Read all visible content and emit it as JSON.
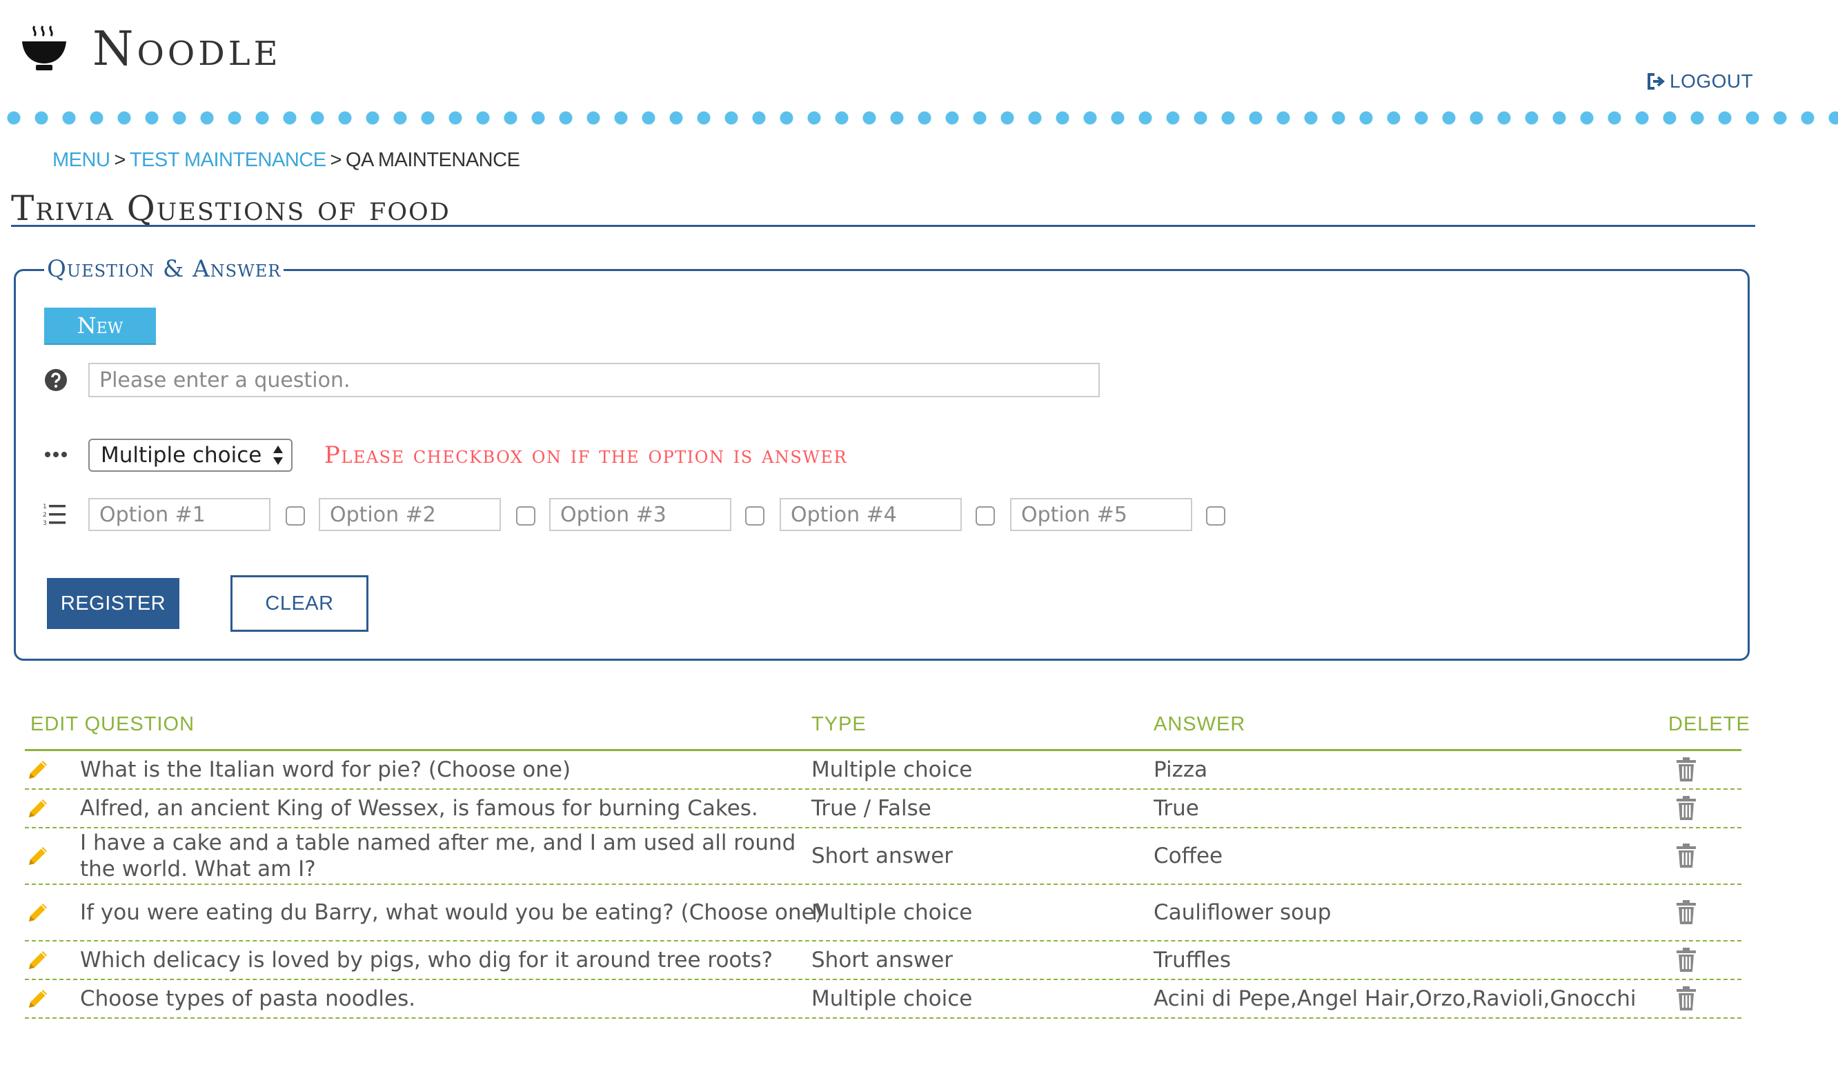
{
  "header": {
    "brand": "Noodle",
    "logout_label": "LOGOUT"
  },
  "breadcrumb": {
    "items": [
      "MENU",
      "TEST MAINTENANCE",
      "QA MAINTENANCE"
    ],
    "separator": ">"
  },
  "page": {
    "title": "Trivia Questions of food"
  },
  "form": {
    "legend": "Question & Answer",
    "new_label": "New",
    "question_placeholder": "Please enter a question.",
    "question_value": "",
    "type_selected": "Multiple choice",
    "warning": "Please checkbox on if the option is answer",
    "options": [
      {
        "placeholder": "Option #1",
        "checked": false
      },
      {
        "placeholder": "Option #2",
        "checked": false
      },
      {
        "placeholder": "Option #3",
        "checked": false
      },
      {
        "placeholder": "Option #4",
        "checked": false
      },
      {
        "placeholder": "Option #5",
        "checked": false
      }
    ],
    "register_label": "REGISTER",
    "clear_label": "CLEAR"
  },
  "table": {
    "headers": {
      "edit_question": "EDIT QUESTION",
      "type": "TYPE",
      "answer": "ANSWER",
      "delete": "DELETE"
    },
    "rows": [
      {
        "question": "What is the Italian word for pie? (Choose one)",
        "type": "Multiple choice",
        "answer": "Pizza"
      },
      {
        "question": "Alfred, an ancient King of Wessex, is famous for burning Cakes.",
        "type": "True / False",
        "answer": "True"
      },
      {
        "question": "I have a cake and a table named after me, and I am used all round the world. What am I?",
        "type": "Short answer",
        "answer": "Coffee"
      },
      {
        "question": "If you were eating du Barry, what would you be eating? (Choose one)",
        "type": "Multiple choice",
        "answer": "Cauliflower soup"
      },
      {
        "question": "Which delicacy is loved by pigs, who dig for it around tree roots?",
        "type": "Short answer",
        "answer": "Truffles"
      },
      {
        "question": "Choose types of pasta noodles.",
        "type": "Multiple choice",
        "answer": "Acini di Pepe,Angel Hair,Orzo,Ravioli,Gnocchi"
      }
    ]
  },
  "colors": {
    "brand_blue": "#2b5b91",
    "accent_cyan": "#45b4e3",
    "table_green": "#8cb33a",
    "warning_red": "#ff5a5f",
    "edit_yellow": "#f5b700"
  },
  "icons": {
    "logo": "noodle-bowl-icon",
    "logout": "logout-icon",
    "question": "question-circle-icon",
    "type": "ellipsis-icon",
    "options": "list-ol-icon",
    "edit": "pencil-icon",
    "delete": "trash-icon",
    "select": "select-arrows-icon"
  }
}
